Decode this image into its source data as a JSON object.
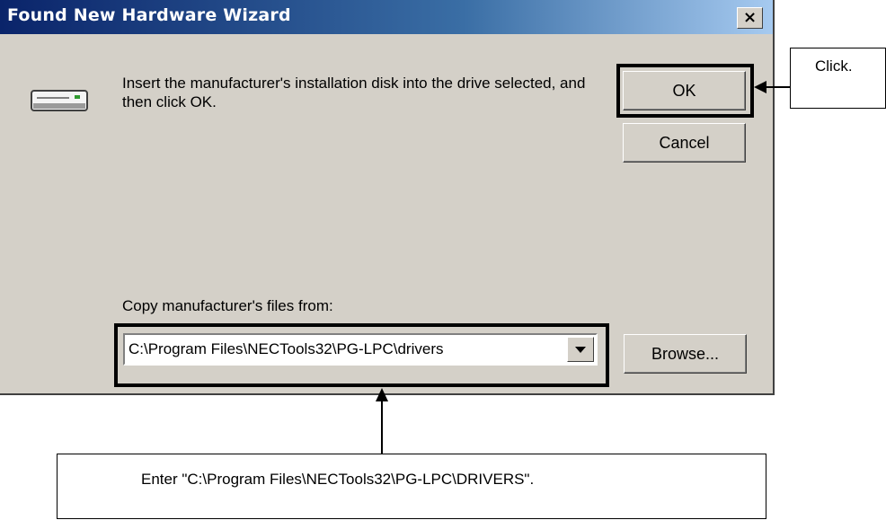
{
  "dialog": {
    "title": "Found New Hardware Wizard",
    "close_label": "×",
    "message": "Insert the manufacturer's installation disk into the drive selected, and then click OK.",
    "ok_label": "OK",
    "cancel_label": "Cancel",
    "copy_label": "Copy manufacturer's files from:",
    "path_value": "C:\\Program Files\\NECTools32\\PG-LPC\\drivers",
    "browse_label": "Browse..."
  },
  "annotations": {
    "click_note": "Click.",
    "enter_note": "Enter \"C:\\Program Files\\NECTools32\\PG-LPC\\DRIVERS\"."
  }
}
